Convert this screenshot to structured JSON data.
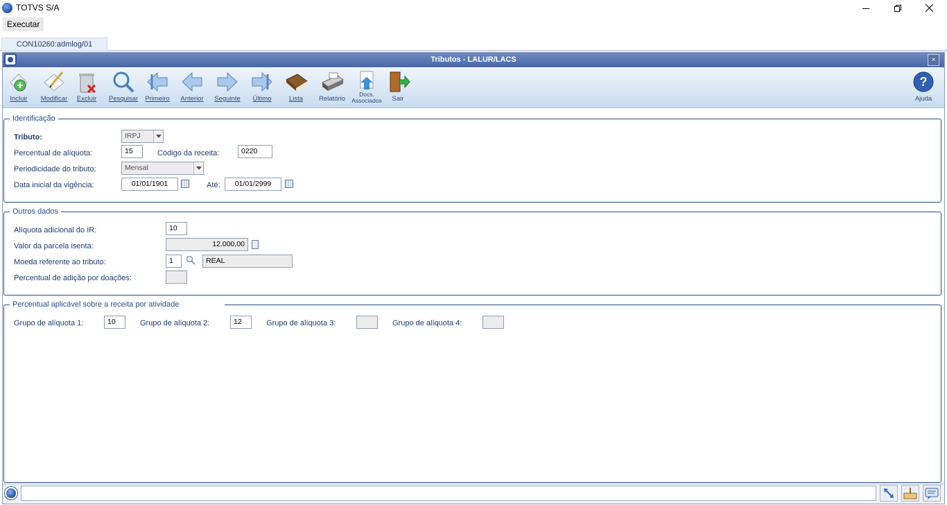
{
  "window": {
    "title": "TOTVS S/A"
  },
  "menu": {
    "executar": "Executar"
  },
  "tab": {
    "label": "CON10260:admlog/01"
  },
  "dialog": {
    "title": "Tributos - LALUR/LACS",
    "close": "×"
  },
  "toolbar": {
    "incluir": "Incluir",
    "modificar": "Modificar",
    "excluir": "Excluir",
    "pesquisar": "Pesquisar",
    "primeiro": "Primeiro",
    "anterior": "Anterior",
    "seguinte": "Seguinte",
    "ultimo": "Último",
    "lista": "Lista",
    "relatorio": "Relatório",
    "docs_line1": "Docs.",
    "docs_line2": "Associados",
    "sair": "Sair",
    "ajuda": "Ajuda"
  },
  "identificacao": {
    "title": "Identificação",
    "tributo_label": "Tributo:",
    "tributo_value": "IRPJ",
    "percentual_label": "Percentual de alíquota:",
    "percentual_value": "15",
    "codigo_label": "Código da receita:",
    "codigo_value": "0220",
    "periodicidade_label": "Periodicidade do tributo:",
    "periodicidade_value": "Mensal",
    "data_inicial_label": "Data inicial da vigência:",
    "data_inicial_value": "01/01/1901",
    "ate_label": "Até:",
    "ate_value": "01/01/2999"
  },
  "outros": {
    "title": "Outros dados",
    "aliquota_adicional_label": "Alíquota adicional do IR:",
    "aliquota_adicional_value": "10",
    "valor_parcela_label": "Valor da parcela isenta:",
    "valor_parcela_value": "12.000,00",
    "moeda_label": "Moeda referente ao tributo:",
    "moeda_code": "1",
    "moeda_name": "REAL",
    "percentual_doacoes_label": "Percentual de adição por doações:",
    "percentual_doacoes_value": ""
  },
  "atividade": {
    "title": "Percentual aplicável sobre a receita por atividade",
    "grupo1_label": "Grupo de alíquota 1:",
    "grupo1_value": "10",
    "grupo2_label": "Grupo de alíquota 2:",
    "grupo2_value": "12",
    "grupo3_label": "Grupo de alíquota 3:",
    "grupo3_value": "",
    "grupo4_label": "Grupo de alíquota 4:",
    "grupo4_value": ""
  },
  "colors": {
    "header": "#4a68a6",
    "label": "#1f3a6e",
    "group_border": "#264d8c"
  }
}
